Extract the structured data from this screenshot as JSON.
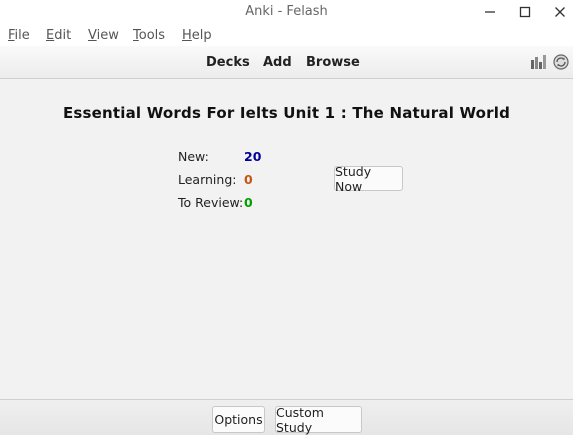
{
  "window": {
    "title": "Anki - Felash"
  },
  "menu": {
    "file": {
      "accel": "F",
      "rest": "ile"
    },
    "edit": {
      "accel": "E",
      "rest": "dit"
    },
    "view": {
      "accel": "V",
      "rest": "iew"
    },
    "tools": {
      "accel": "T",
      "rest": "ools"
    },
    "help": {
      "accel": "H",
      "rest": "elp"
    }
  },
  "toolbar": {
    "decks": "Decks",
    "add": "Add",
    "browse": "Browse",
    "icons": [
      "stats-icon",
      "sync-icon"
    ]
  },
  "deck": {
    "title": "Essential Words For Ielts Unit 1 : The Natural World",
    "stats": {
      "new_label": "New:",
      "new_value": "20",
      "learning_label": "Learning:",
      "learning_value": "0",
      "review_label": "To Review:",
      "review_value": "0"
    },
    "study_button": "Study Now"
  },
  "bottom": {
    "options": "Options",
    "custom_study": "Custom Study"
  },
  "colors": {
    "new": "#000099",
    "learning": "#c35617",
    "review": "#00a000"
  }
}
